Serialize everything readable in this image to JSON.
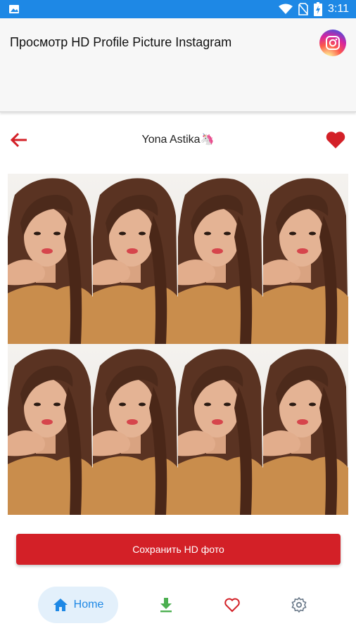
{
  "status_bar": {
    "time": "3:11",
    "icons": [
      "image-icon",
      "wifi-icon",
      "no-sim-icon",
      "battery-charging-icon"
    ]
  },
  "app_bar": {
    "title": "Просмотр HD Profile Picture Instagram",
    "logo_icon": "instagram-icon"
  },
  "profile": {
    "name": "Yona Astika🦄",
    "back_icon": "arrow-left-icon",
    "favorite_icon": "heart-icon"
  },
  "actions": {
    "save_label": "Сохранить HD фото"
  },
  "bottom_nav": {
    "items": [
      {
        "label": "Home",
        "icon": "home-icon",
        "active": true
      },
      {
        "label": "",
        "icon": "download-icon"
      },
      {
        "label": "",
        "icon": "heart-outline-icon"
      },
      {
        "label": "",
        "icon": "settings-icon"
      }
    ]
  },
  "colors": {
    "status_bar": "#1e88e5",
    "accent_red": "#d32027",
    "nav_active_bg": "#e3f0fb",
    "nav_active_text": "#1e88e5",
    "download_green": "#4caf50"
  }
}
